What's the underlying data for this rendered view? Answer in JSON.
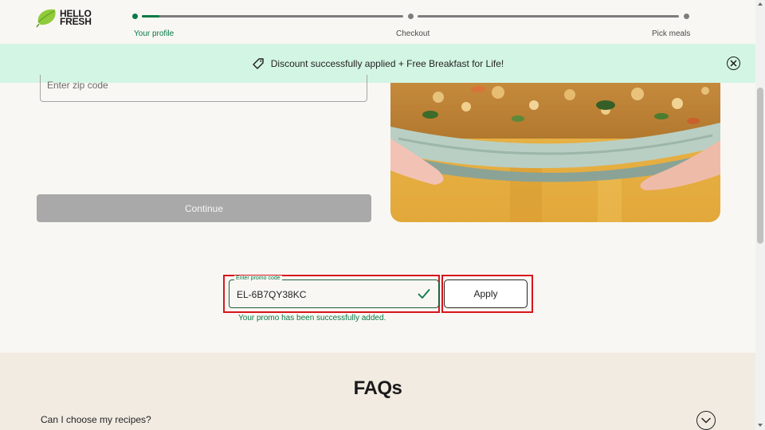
{
  "header": {
    "logo_line1": "HELLO",
    "logo_line2": "FRESH",
    "steps": [
      {
        "label": "Your profile",
        "active": true
      },
      {
        "label": "Checkout",
        "active": false
      },
      {
        "label": "Pick meals",
        "active": false
      }
    ]
  },
  "banner": {
    "message": "Discount successfully applied + Free Breakfast for Life!",
    "tag_icon": "tag-icon",
    "close_icon": "close-circle-icon"
  },
  "form": {
    "zip_placeholder": "Enter zip code",
    "zip_value": "",
    "continue_label": "Continue"
  },
  "promo": {
    "label": "Enter promo code",
    "value": "EL-6B7QY38KC",
    "apply_label": "Apply",
    "success_message": "Your promo has been successfully added."
  },
  "faq": {
    "title": "FAQs",
    "items": [
      {
        "question": "Can I choose my recipes?"
      }
    ]
  },
  "colors": {
    "brand_green": "#067a46",
    "banner_bg": "#d3f5e3",
    "faq_bg": "#f1ebe2",
    "page_bg": "#f9f7f3",
    "highlight_red": "#d7161c",
    "disabled_button": "#a9a9a9"
  }
}
